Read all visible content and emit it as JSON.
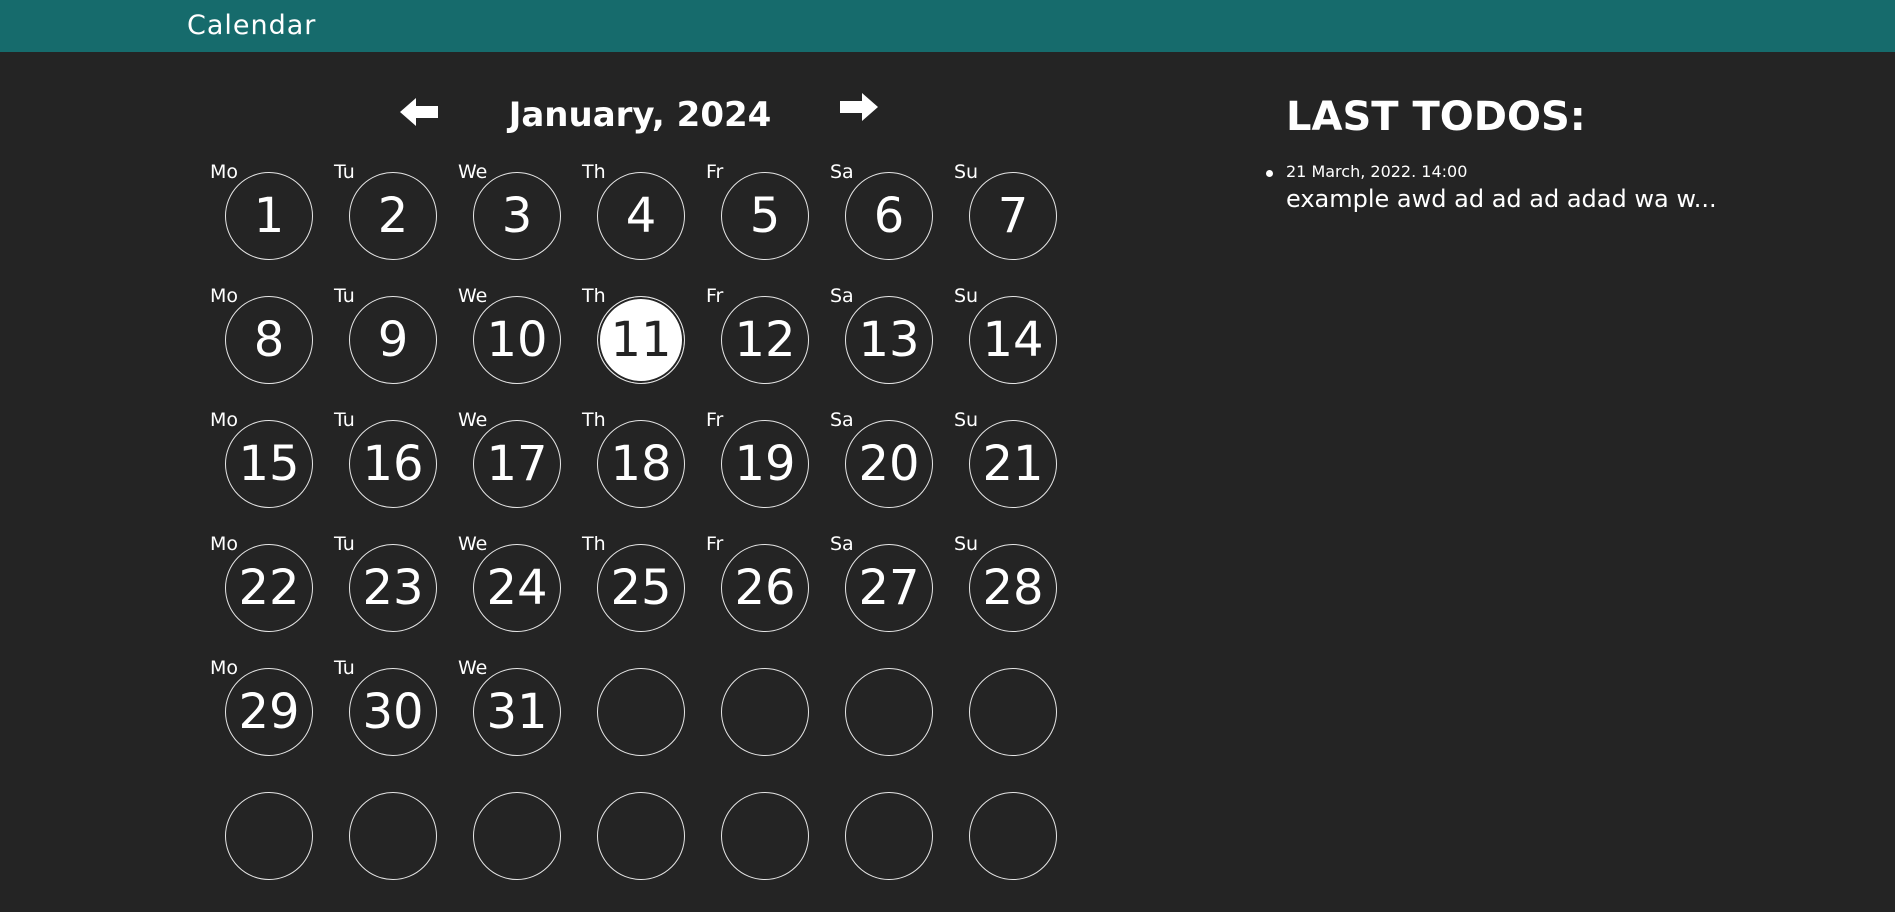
{
  "app": {
    "title": "Calendar"
  },
  "calendar": {
    "month_title": "January, 2024",
    "prev_icon": "arrow-left-icon",
    "next_icon": "arrow-right-icon",
    "today": 11,
    "weeks": [
      [
        {
          "wd": "Mo",
          "d": "1"
        },
        {
          "wd": "Tu",
          "d": "2"
        },
        {
          "wd": "We",
          "d": "3"
        },
        {
          "wd": "Th",
          "d": "4"
        },
        {
          "wd": "Fr",
          "d": "5"
        },
        {
          "wd": "Sa",
          "d": "6"
        },
        {
          "wd": "Su",
          "d": "7"
        }
      ],
      [
        {
          "wd": "Mo",
          "d": "8"
        },
        {
          "wd": "Tu",
          "d": "9"
        },
        {
          "wd": "We",
          "d": "10"
        },
        {
          "wd": "Th",
          "d": "11"
        },
        {
          "wd": "Fr",
          "d": "12"
        },
        {
          "wd": "Sa",
          "d": "13"
        },
        {
          "wd": "Su",
          "d": "14"
        }
      ],
      [
        {
          "wd": "Mo",
          "d": "15"
        },
        {
          "wd": "Tu",
          "d": "16"
        },
        {
          "wd": "We",
          "d": "17"
        },
        {
          "wd": "Th",
          "d": "18"
        },
        {
          "wd": "Fr",
          "d": "19"
        },
        {
          "wd": "Sa",
          "d": "20"
        },
        {
          "wd": "Su",
          "d": "21"
        }
      ],
      [
        {
          "wd": "Mo",
          "d": "22"
        },
        {
          "wd": "Tu",
          "d": "23"
        },
        {
          "wd": "We",
          "d": "24"
        },
        {
          "wd": "Th",
          "d": "25"
        },
        {
          "wd": "Fr",
          "d": "26"
        },
        {
          "wd": "Sa",
          "d": "27"
        },
        {
          "wd": "Su",
          "d": "28"
        }
      ],
      [
        {
          "wd": "Mo",
          "d": "29"
        },
        {
          "wd": "Tu",
          "d": "30"
        },
        {
          "wd": "We",
          "d": "31"
        },
        {
          "wd": "",
          "d": ""
        },
        {
          "wd": "",
          "d": ""
        },
        {
          "wd": "",
          "d": ""
        },
        {
          "wd": "",
          "d": ""
        }
      ],
      [
        {
          "wd": "",
          "d": ""
        },
        {
          "wd": "",
          "d": ""
        },
        {
          "wd": "",
          "d": ""
        },
        {
          "wd": "",
          "d": ""
        },
        {
          "wd": "",
          "d": ""
        },
        {
          "wd": "",
          "d": ""
        },
        {
          "wd": "",
          "d": ""
        }
      ]
    ]
  },
  "todos": {
    "title": "LAST TODOS:",
    "items": [
      {
        "date": "21 March, 2022. 14:00",
        "text": "example awd ad ad ad adad wa w..."
      }
    ]
  },
  "colors": {
    "header_bg": "#166b6c",
    "page_bg": "#242424",
    "text": "#ffffff"
  }
}
